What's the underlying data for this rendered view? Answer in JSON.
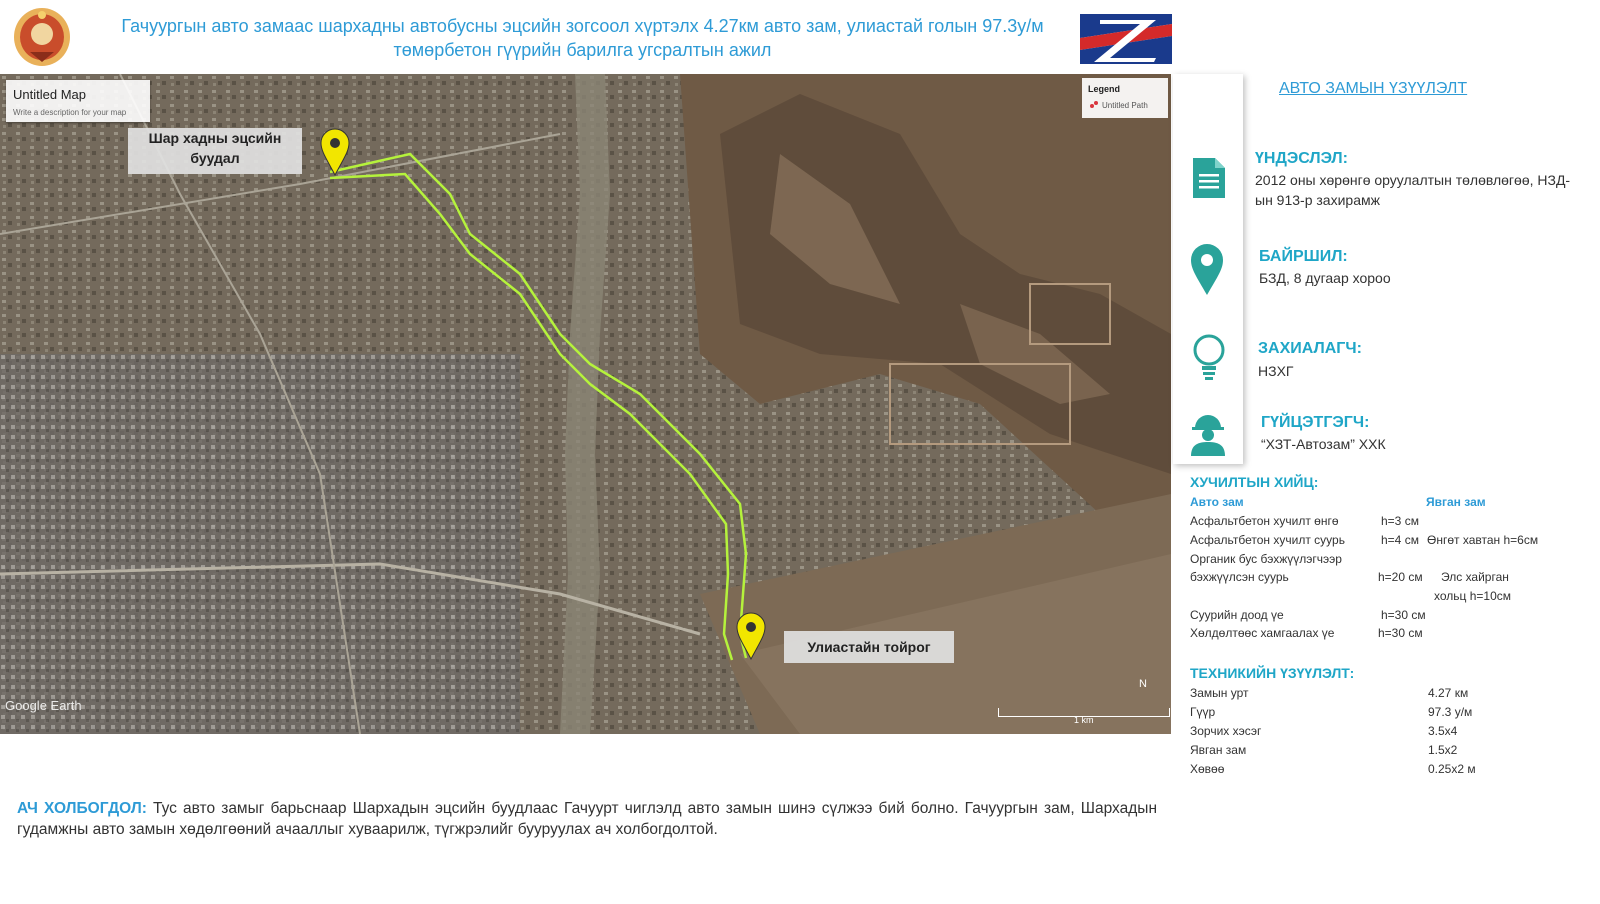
{
  "header": {
    "title": "Гачуургын авто замаас шархадны автобусны эцсийн зогсоол хүртэлх 4.27км авто зам, улиастай голын 97.3у/м төмөрбетон гүүрийн барилга угсралтын ажил"
  },
  "map": {
    "title": "Untitled Map",
    "description": "Write a description for your map",
    "legend_title": "Legend",
    "legend_item": "Untitled Path",
    "label_start": "Шар хадны эцсийн буудал",
    "label_end": "Улиастайн тойрог",
    "watermark": "Google Earth",
    "scale_label": "1 km",
    "north": "N"
  },
  "panel": {
    "heading": "АВТО ЗАМЫН ҮЗҮҮЛЭЛТ",
    "basis_title": "ҮНДЭСЛЭЛ:",
    "basis_text": "2012 оны хөрөнгө оруулалтын төлөвлөгөө, НЗД-ын 913-р захирамж",
    "location_title": "БАЙРШИЛ:",
    "location_text": "БЗД, 8 дугаар хороо",
    "client_title": "ЗАХИАЛАГЧ:",
    "client_text": "НЗХГ",
    "contractor_title": "ГҮЙЦЭТГЭГЧ:",
    "contractor_text": "“ХЗТ-Автозам” ХХК",
    "pavement_title": "ХУЧИЛТЫН ХИЙЦ:",
    "pavement_col_road": "Авто зам",
    "pavement_col_walk": "Явган зам",
    "pavement_rows": [
      {
        "label": "Асфальтбетон хучилт өнгө",
        "road": "h=3 см",
        "walk": ""
      },
      {
        "label": "Асфальтбетон хучилт суурь",
        "road": "h=4 см",
        "walk": "Өнгөт хавтан h=6см"
      },
      {
        "label": "Органик бус бэхжүүлэгчээр",
        "road": "",
        "walk": ""
      },
      {
        "label": "бэхжүүлсэн суурь",
        "road": "h=20 см",
        "walk": "Элс хайрган"
      },
      {
        "label": "",
        "road": "",
        "walk": "хольц h=10см"
      },
      {
        "label": "Суурийн доод үе",
        "road": "h=30 см",
        "walk": ""
      },
      {
        "label": "Хөлдөлтөөс хамгаалах үе",
        "road": "h=30 см",
        "walk": ""
      }
    ],
    "tech_title": "ТЕХНИКИЙН ҮЗҮҮЛЭЛТ:",
    "tech_rows": [
      {
        "label": "Замын урт",
        "value": "4.27 км"
      },
      {
        "label": "Гүүр",
        "value": "97.3 у/м"
      },
      {
        "label": "Зорчих хэсэг",
        "value": "3.5х4"
      },
      {
        "label": "Явган зам",
        "value": "1.5х2"
      },
      {
        "label": "Хөвөө",
        "value": "0.25х2 м"
      }
    ]
  },
  "bottom": {
    "label": "АЧ ХОЛБОГДОЛ:",
    "text": " Тус авто замыг барьснаар Шархадын эцсийн буудлаас Гачуурт чиглэлд авто замын шинэ сүлжээ бий болно. Гачуургын зам, Шархадын гудамжны авто замын хөдөлгөөний ачааллыг хуваарилж, түгжрэлийг бууруулах ач холбогдолтой."
  },
  "colors": {
    "accent": "#2e9bd6",
    "teal": "#1fa6c7",
    "route": "#b5f23c",
    "pin": "#f2e600"
  }
}
